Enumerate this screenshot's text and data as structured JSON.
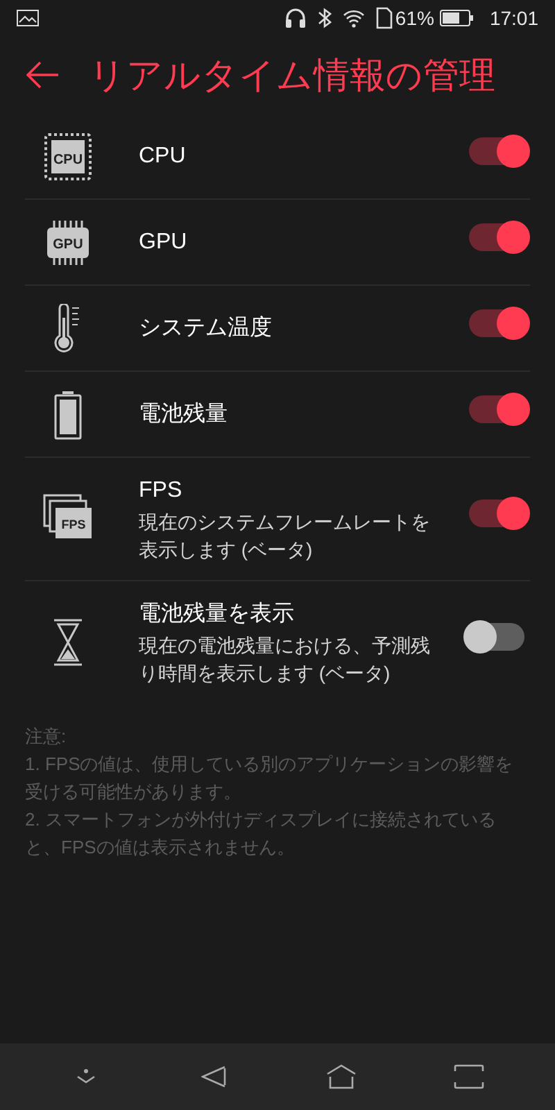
{
  "status_bar": {
    "battery_percent": "61%",
    "time": "17:01"
  },
  "header": {
    "title": "リアルタイム情報の管理"
  },
  "items": [
    {
      "kind": "chip",
      "icon_label": "CPU",
      "title": "CPU",
      "on": true
    },
    {
      "kind": "gpu",
      "icon_label": "GPU",
      "title": "GPU",
      "on": true
    },
    {
      "kind": "thermometer",
      "title": "システム温度",
      "on": true
    },
    {
      "kind": "battery",
      "title": "電池残量",
      "on": true
    },
    {
      "kind": "frames",
      "icon_label": "FPS",
      "title": "FPS",
      "description": "現在のシステムフレームレートを表示します (ベータ)",
      "on": true
    },
    {
      "kind": "hourglass",
      "title": "電池残量を表示",
      "description": "現在の電池残量における、予測残り時間を表示します (ベータ)",
      "on": false
    }
  ],
  "notes": [
    "注意:",
    "1. FPSの値は、使用している別のアプリケーションの影響を受ける可能性があります。",
    "2. スマートフォンが外付けディスプレイに接続されていると、FPSの値は表示されません。"
  ]
}
